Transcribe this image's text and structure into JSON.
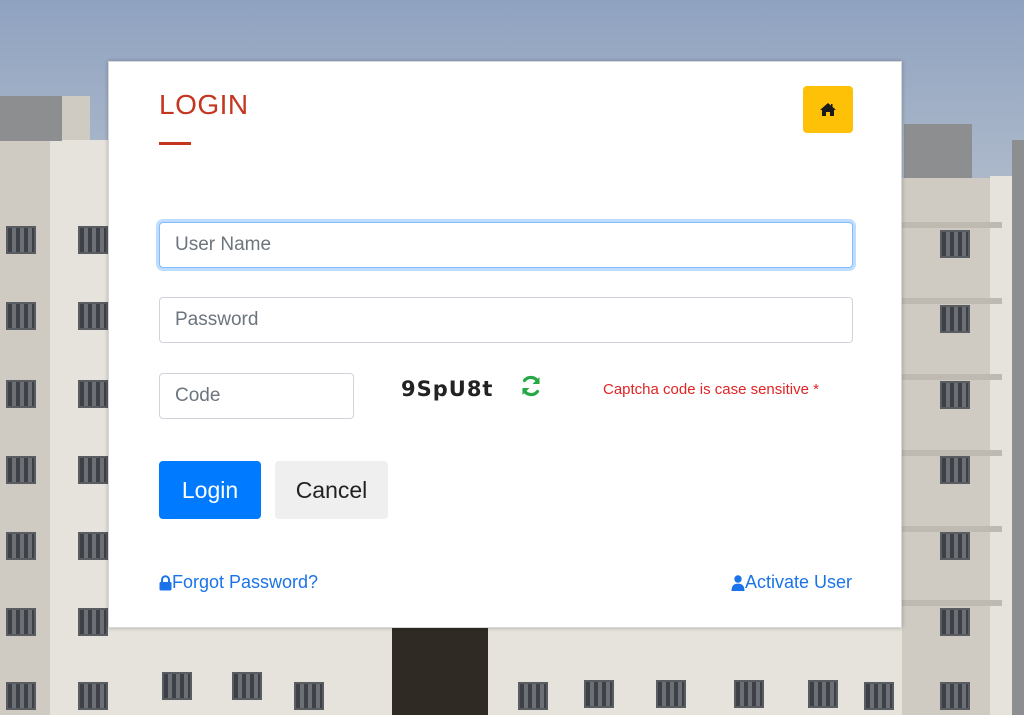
{
  "card": {
    "title": "LOGIN",
    "home_icon": "home-icon"
  },
  "form": {
    "username": {
      "placeholder": "User Name",
      "value": ""
    },
    "password": {
      "placeholder": "Password",
      "value": ""
    },
    "code": {
      "placeholder": "Code",
      "value": ""
    },
    "captcha_text": "9SpU8t",
    "refresh_icon": "refresh-icon",
    "captcha_note": "Captcha code is case sensitive *"
  },
  "actions": {
    "login_label": "Login",
    "cancel_label": "Cancel"
  },
  "links": {
    "forgot_password": "Forgot Password?",
    "forgot_icon": "lock-icon",
    "activate_user": "Activate User",
    "activate_icon": "user-icon"
  },
  "colors": {
    "title": "#c4361f",
    "home_button": "#ffc107",
    "primary": "#007bff",
    "note": "#e02424",
    "refresh": "#28a745"
  }
}
